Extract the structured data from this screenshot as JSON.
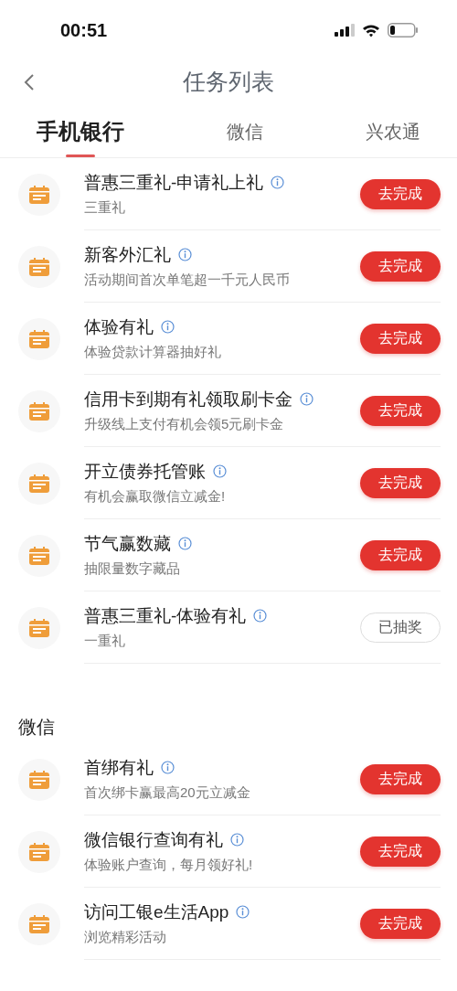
{
  "status_bar": {
    "time": "00:51"
  },
  "header": {
    "title": "任务列表"
  },
  "tabs": [
    {
      "label": "手机银行",
      "selected": true
    },
    {
      "label": "微信",
      "selected": false
    },
    {
      "label": "兴农通",
      "selected": false
    }
  ],
  "sections": [
    {
      "items": [
        {
          "title": "普惠三重礼-申请礼上礼",
          "subtitle": "三重礼",
          "button": "去完成",
          "completed": false
        },
        {
          "title": "新客外汇礼",
          "subtitle": "活动期间首次单笔超一千元人民币",
          "button": "去完成",
          "completed": false
        },
        {
          "title": "体验有礼",
          "subtitle": "体验贷款计算器抽好礼",
          "button": "去完成",
          "completed": false
        },
        {
          "title": "信用卡到期有礼领取刷卡金",
          "subtitle": "升级线上支付有机会领5元刷卡金",
          "button": "去完成",
          "completed": false
        },
        {
          "title": "开立债券托管账",
          "subtitle": "有机会赢取微信立减金!",
          "button": "去完成",
          "completed": false
        },
        {
          "title": "节气赢数藏",
          "subtitle": "抽限量数字藏品",
          "button": "去完成",
          "completed": false
        },
        {
          "title": "普惠三重礼-体验有礼",
          "subtitle": "一重礼",
          "button": "已抽奖",
          "completed": true
        }
      ]
    },
    {
      "heading": "微信",
      "items": [
        {
          "title": "首绑有礼",
          "subtitle": "首次绑卡赢最高20元立减金",
          "button": "去完成",
          "completed": false
        },
        {
          "title": "微信银行查询有礼",
          "subtitle": "体验账户查询，每月领好礼!",
          "button": "去完成",
          "completed": false
        },
        {
          "title": "访问工银e生活App",
          "subtitle": "浏览精彩活动",
          "button": "去完成",
          "completed": false
        }
      ]
    }
  ]
}
